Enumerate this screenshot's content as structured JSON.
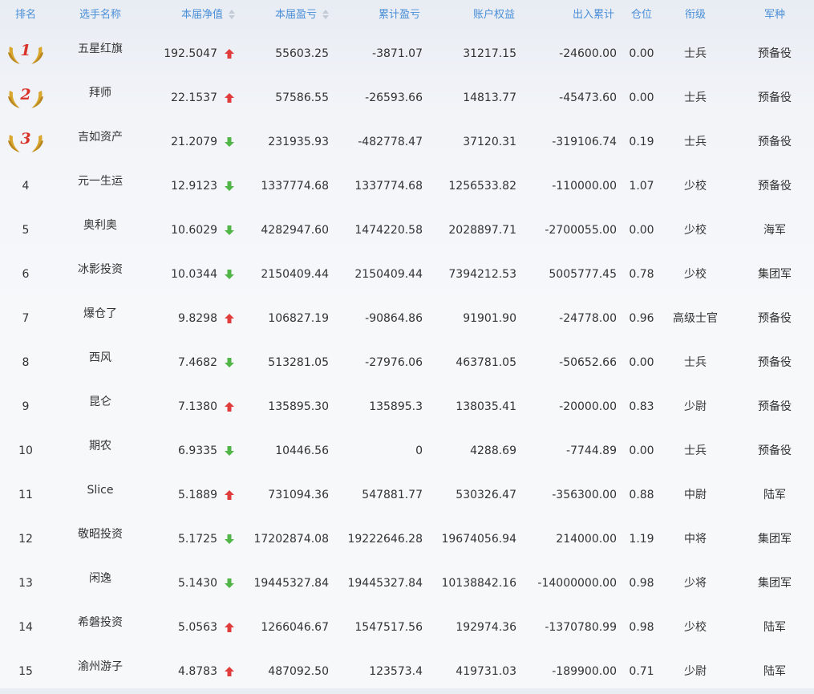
{
  "colors": {
    "header_text": "#4a8fd8",
    "up": "#e03c3c",
    "down": "#52b548",
    "medal_gold": "#d9a62e",
    "medal_rank": "#d8342a"
  },
  "headers": {
    "rank": "排名",
    "name": "选手名称",
    "nav": "本届净值",
    "pnl": "本届盈亏",
    "cum_pnl": "累计盈亏",
    "equity": "账户权益",
    "flow": "出入累计",
    "position": "仓位",
    "grade": "衔级",
    "branch": "军种"
  },
  "rows": [
    {
      "rank": "1",
      "medal": true,
      "name": "五星红旗",
      "nav": "192.5047",
      "trend": "up",
      "pnl": "55603.25",
      "cum_pnl": "-3871.07",
      "equity": "31217.15",
      "flow": "-24600.00",
      "position": "0.00",
      "grade": "士兵",
      "branch": "预备役"
    },
    {
      "rank": "2",
      "medal": true,
      "name": "拜师",
      "nav": "22.1537",
      "trend": "up",
      "pnl": "57586.55",
      "cum_pnl": "-26593.66",
      "equity": "14813.77",
      "flow": "-45473.60",
      "position": "0.00",
      "grade": "士兵",
      "branch": "预备役"
    },
    {
      "rank": "3",
      "medal": true,
      "name": "吉如资产",
      "nav": "21.2079",
      "trend": "down",
      "pnl": "231935.93",
      "cum_pnl": "-482778.47",
      "equity": "37120.31",
      "flow": "-319106.74",
      "position": "0.19",
      "grade": "士兵",
      "branch": "预备役"
    },
    {
      "rank": "4",
      "medal": false,
      "name": "元一生运",
      "nav": "12.9123",
      "trend": "down",
      "pnl": "1337774.68",
      "cum_pnl": "1337774.68",
      "equity": "1256533.82",
      "flow": "-110000.00",
      "position": "1.07",
      "grade": "少校",
      "branch": "预备役"
    },
    {
      "rank": "5",
      "medal": false,
      "name": "奥利奥",
      "nav": "10.6029",
      "trend": "down",
      "pnl": "4282947.60",
      "cum_pnl": "1474220.58",
      "equity": "2028897.71",
      "flow": "-2700055.00",
      "position": "0.00",
      "grade": "少校",
      "branch": "海军"
    },
    {
      "rank": "6",
      "medal": false,
      "name": "冰影投资",
      "nav": "10.0344",
      "trend": "down",
      "pnl": "2150409.44",
      "cum_pnl": "2150409.44",
      "equity": "7394212.53",
      "flow": "5005777.45",
      "position": "0.78",
      "grade": "少校",
      "branch": "集团军"
    },
    {
      "rank": "7",
      "medal": false,
      "name": "爆仓了",
      "nav": "9.8298",
      "trend": "up",
      "pnl": "106827.19",
      "cum_pnl": "-90864.86",
      "equity": "91901.90",
      "flow": "-24778.00",
      "position": "0.96",
      "grade": "高级士官",
      "branch": "预备役"
    },
    {
      "rank": "8",
      "medal": false,
      "name": "西风",
      "nav": "7.4682",
      "trend": "down",
      "pnl": "513281.05",
      "cum_pnl": "-27976.06",
      "equity": "463781.05",
      "flow": "-50652.66",
      "position": "0.00",
      "grade": "士兵",
      "branch": "预备役"
    },
    {
      "rank": "9",
      "medal": false,
      "name": "昆仑",
      "nav": "7.1380",
      "trend": "up",
      "pnl": "135895.30",
      "cum_pnl": "135895.3",
      "equity": "138035.41",
      "flow": "-20000.00",
      "position": "0.83",
      "grade": "少尉",
      "branch": "预备役"
    },
    {
      "rank": "10",
      "medal": false,
      "name": "期农",
      "nav": "6.9335",
      "trend": "down",
      "pnl": "10446.56",
      "cum_pnl": "0",
      "equity": "4288.69",
      "flow": "-7744.89",
      "position": "0.00",
      "grade": "士兵",
      "branch": "预备役"
    },
    {
      "rank": "11",
      "medal": false,
      "name": "Slice",
      "nav": "5.1889",
      "trend": "up",
      "pnl": "731094.36",
      "cum_pnl": "547881.77",
      "equity": "530326.47",
      "flow": "-356300.00",
      "position": "0.88",
      "grade": "中尉",
      "branch": "陆军"
    },
    {
      "rank": "12",
      "medal": false,
      "name": "敬昭投资",
      "nav": "5.1725",
      "trend": "down",
      "pnl": "17202874.08",
      "cum_pnl": "19222646.28",
      "equity": "19674056.94",
      "flow": "214000.00",
      "position": "1.19",
      "grade": "中将",
      "branch": "集团军"
    },
    {
      "rank": "13",
      "medal": false,
      "name": "闲逸",
      "nav": "5.1430",
      "trend": "down",
      "pnl": "19445327.84",
      "cum_pnl": "19445327.84",
      "equity": "10138842.16",
      "flow": "-14000000.00",
      "position": "0.98",
      "grade": "少将",
      "branch": "集团军"
    },
    {
      "rank": "14",
      "medal": false,
      "name": "希磐投资",
      "nav": "5.0563",
      "trend": "up",
      "pnl": "1266046.67",
      "cum_pnl": "1547517.56",
      "equity": "192974.36",
      "flow": "-1370780.99",
      "position": "0.98",
      "grade": "少校",
      "branch": "陆军"
    },
    {
      "rank": "15",
      "medal": false,
      "name": "渝州游子",
      "nav": "4.8783",
      "trend": "up",
      "pnl": "487092.50",
      "cum_pnl": "123573.4",
      "equity": "419731.03",
      "flow": "-189900.00",
      "position": "0.71",
      "grade": "少尉",
      "branch": "陆军"
    }
  ]
}
